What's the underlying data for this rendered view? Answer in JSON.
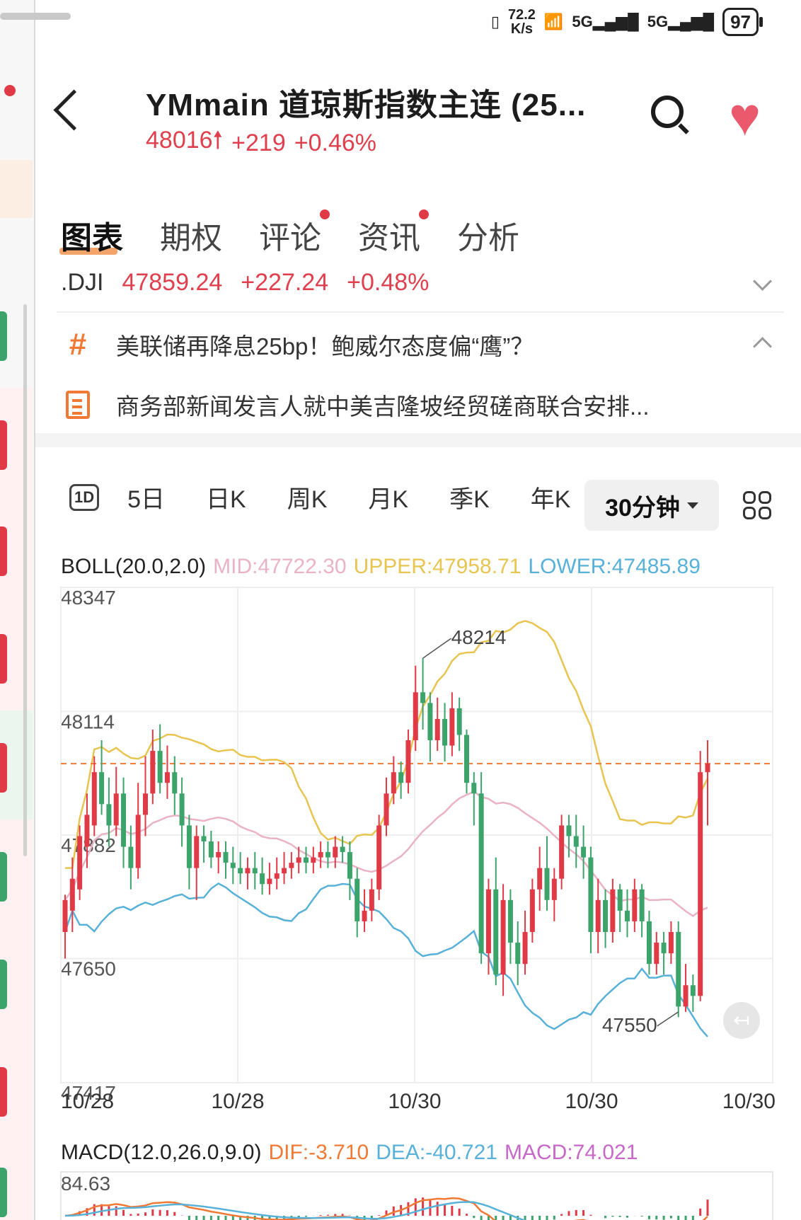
{
  "status_bar": {
    "net_speed_value": "72.2",
    "net_speed_unit": "K/s",
    "signal_1": "5G",
    "signal_2": "5G",
    "battery": "97"
  },
  "header": {
    "title": "YMmain  道琼斯指数主连 (25...",
    "price": "48016",
    "change": "+219",
    "change_pct": "+0.46%"
  },
  "tabs": [
    {
      "label": "图表",
      "active": true,
      "dot": false
    },
    {
      "label": "期权",
      "active": false,
      "dot": false
    },
    {
      "label": "评论",
      "active": false,
      "dot": true
    },
    {
      "label": "资讯",
      "active": false,
      "dot": true
    },
    {
      "label": "分析",
      "active": false,
      "dot": false
    }
  ],
  "index_row": {
    "symbol": ".DJI",
    "price": "47859.24",
    "change": "+227.24",
    "change_pct": "+0.48%"
  },
  "news": [
    {
      "icon": "hashtag-icon",
      "text": "美联储再降息25bp！鲍威尔态度偏“鹰”？"
    },
    {
      "icon": "document-icon",
      "text": "商务部新闻发言人就中美吉隆坡经贸磋商联合安排..."
    }
  ],
  "periods": [
    "5日",
    "日K",
    "周K",
    "月K",
    "季K",
    "年K"
  ],
  "period_1d": "1D",
  "selected_period": "30分钟",
  "boll": {
    "name": "BOLL(20.0,2.0)",
    "mid": "MID:47722.30",
    "upper": "UPPER:47958.71",
    "lower": "LOWER:47485.89"
  },
  "macd": {
    "name": "MACD(12.0,26.0,9.0)",
    "dif": "DIF:-3.710",
    "dea": "DEA:-40.721",
    "macd": "MACD:74.021",
    "top_label": "84.63"
  },
  "colors": {
    "up": "#e03a47",
    "down": "#3ca36b",
    "mid": "#eab3c5",
    "upper": "#e8c451",
    "lower": "#58b1d8",
    "price_line": "#f07a35",
    "heart": "#ea5a6c"
  },
  "chart_data": {
    "type": "candlestick",
    "y_ticks": [
      48347,
      48114,
      47882,
      47650,
      47417
    ],
    "ylim": [
      47417,
      48347
    ],
    "x_tick_labels": [
      "10/28",
      "10/28",
      "10/30",
      "10/30",
      "10/30"
    ],
    "current_price": 48016,
    "annotations": [
      {
        "label": "48214",
        "value": 48214,
        "index": 49
      },
      {
        "label": "47550",
        "value": 47550,
        "index": 84
      }
    ],
    "candles": [
      [
        47700,
        47760,
        47650,
        47770
      ],
      [
        47740,
        47800,
        47700,
        47840
      ],
      [
        47780,
        47880,
        47760,
        47900
      ],
      [
        47860,
        47920,
        47820,
        47960
      ],
      [
        47900,
        48000,
        47880,
        48030
      ],
      [
        48000,
        47940,
        47920,
        48060
      ],
      [
        47940,
        47900,
        47860,
        47990
      ],
      [
        47900,
        47960,
        47880,
        48010
      ],
      [
        47960,
        47860,
        47820,
        47990
      ],
      [
        47860,
        47820,
        47780,
        47900
      ],
      [
        47820,
        47920,
        47800,
        47980
      ],
      [
        47920,
        47960,
        47880,
        48030
      ],
      [
        47960,
        48040,
        47940,
        48080
      ],
      [
        48040,
        47980,
        47960,
        48090
      ],
      [
        47980,
        48000,
        47950,
        48050
      ],
      [
        48000,
        47960,
        47920,
        48030
      ],
      [
        47960,
        47900,
        47860,
        47990
      ],
      [
        47900,
        47820,
        47780,
        47920
      ],
      [
        47820,
        47880,
        47760,
        47900
      ],
      [
        47880,
        47870,
        47830,
        47900
      ],
      [
        47870,
        47840,
        47820,
        47890
      ],
      [
        47840,
        47850,
        47810,
        47870
      ],
      [
        47850,
        47830,
        47800,
        47870
      ],
      [
        47830,
        47820,
        47790,
        47860
      ],
      [
        47820,
        47810,
        47790,
        47850
      ],
      [
        47810,
        47820,
        47780,
        47840
      ],
      [
        47820,
        47810,
        47780,
        47850
      ],
      [
        47810,
        47790,
        47770,
        47840
      ],
      [
        47790,
        47800,
        47770,
        47830
      ],
      [
        47800,
        47810,
        47780,
        47840
      ],
      [
        47810,
        47820,
        47790,
        47850
      ],
      [
        47820,
        47830,
        47800,
        47850
      ],
      [
        47830,
        47840,
        47810,
        47860
      ],
      [
        47840,
        47830,
        47810,
        47860
      ],
      [
        47830,
        47840,
        47810,
        47860
      ],
      [
        47840,
        47850,
        47820,
        47870
      ],
      [
        47850,
        47840,
        47820,
        47870
      ],
      [
        47840,
        47860,
        47820,
        47880
      ],
      [
        47860,
        47850,
        47830,
        47880
      ],
      [
        47850,
        47800,
        47760,
        47870
      ],
      [
        47800,
        47720,
        47690,
        47820
      ],
      [
        47720,
        47740,
        47700,
        47780
      ],
      [
        47740,
        47780,
        47720,
        47800
      ],
      [
        47780,
        47900,
        47760,
        47920
      ],
      [
        47900,
        47960,
        47880,
        47990
      ],
      [
        47960,
        48000,
        47940,
        48030
      ],
      [
        48000,
        47980,
        47950,
        48020
      ],
      [
        47980,
        48060,
        47960,
        48080
      ],
      [
        48060,
        48150,
        48040,
        48200
      ],
      [
        48150,
        48130,
        48080,
        48214
      ],
      [
        48130,
        48060,
        48020,
        48150
      ],
      [
        48060,
        48100,
        48040,
        48140
      ],
      [
        48100,
        48050,
        48020,
        48130
      ],
      [
        48050,
        48120,
        48030,
        48150
      ],
      [
        48120,
        48070,
        48040,
        48140
      ],
      [
        48070,
        47980,
        47960,
        48080
      ],
      [
        47980,
        47960,
        47900,
        48000
      ],
      [
        47960,
        47660,
        47640,
        48000
      ],
      [
        47660,
        47780,
        47620,
        47800
      ],
      [
        47780,
        47620,
        47600,
        47840
      ],
      [
        47620,
        47760,
        47580,
        47790
      ],
      [
        47760,
        47680,
        47640,
        47780
      ],
      [
        47680,
        47640,
        47600,
        47720
      ],
      [
        47640,
        47700,
        47620,
        47740
      ],
      [
        47700,
        47780,
        47680,
        47800
      ],
      [
        47780,
        47820,
        47740,
        47860
      ],
      [
        47820,
        47760,
        47740,
        47880
      ],
      [
        47760,
        47800,
        47720,
        47820
      ],
      [
        47800,
        47900,
        47780,
        47920
      ],
      [
        47900,
        47880,
        47840,
        47920
      ],
      [
        47880,
        47860,
        47820,
        47920
      ],
      [
        47860,
        47840,
        47800,
        47900
      ],
      [
        47840,
        47700,
        47660,
        47860
      ],
      [
        47700,
        47760,
        47660,
        47800
      ],
      [
        47760,
        47700,
        47670,
        47780
      ],
      [
        47700,
        47780,
        47680,
        47800
      ],
      [
        47780,
        47740,
        47700,
        47790
      ],
      [
        47740,
        47720,
        47690,
        47780
      ],
      [
        47720,
        47780,
        47700,
        47800
      ],
      [
        47780,
        47720,
        47690,
        47790
      ],
      [
        47720,
        47640,
        47620,
        47740
      ],
      [
        47640,
        47680,
        47620,
        47700
      ],
      [
        47680,
        47660,
        47620,
        47700
      ],
      [
        47660,
        47700,
        47640,
        47720
      ],
      [
        47700,
        47560,
        47540,
        47720
      ],
      [
        47560,
        47600,
        47550,
        47640
      ],
      [
        47600,
        47580,
        47550,
        47620
      ],
      [
        47580,
        48000,
        47570,
        48040
      ],
      [
        48000,
        48016,
        47900,
        48060
      ]
    ]
  }
}
